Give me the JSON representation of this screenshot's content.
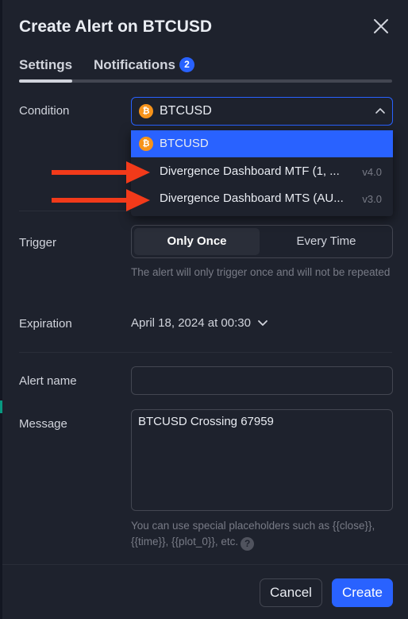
{
  "dialog": {
    "title": "Create Alert on BTCUSD",
    "close_icon": "close-icon"
  },
  "tabs": {
    "settings": "Settings",
    "notifications": "Notifications",
    "notifications_badge": "2"
  },
  "condition": {
    "label": "Condition",
    "selected_value": "BTCUSD",
    "symbol_icon": "bitcoin-icon",
    "options": [
      {
        "label": "BTCUSD",
        "version": "",
        "selected": true
      },
      {
        "label": "Divergence Dashboard MTF (1, ...",
        "version": "v4.0",
        "selected": false
      },
      {
        "label": "Divergence Dashboard MTS (AU...",
        "version": "v3.0",
        "selected": false
      }
    ]
  },
  "trigger": {
    "label": "Trigger",
    "options": [
      "Only Once",
      "Every Time"
    ],
    "selected": "Only Once",
    "hint": "The alert will only trigger once and will not be repeated"
  },
  "expiration": {
    "label": "Expiration",
    "value": "April 18, 2024 at 00:30"
  },
  "alert_name": {
    "label": "Alert name",
    "value": ""
  },
  "message": {
    "label": "Message",
    "value": "BTCUSD Crossing 67959",
    "hint": "You can use special placeholders such as {{close}}, {{time}}, {{plot_0}}, etc."
  },
  "footer": {
    "cancel": "Cancel",
    "create": "Create"
  },
  "colors": {
    "background": "#1e222d",
    "accent": "#2962ff",
    "bitcoin": "#f7931a",
    "annotation_arrow": "#f23a1a"
  }
}
